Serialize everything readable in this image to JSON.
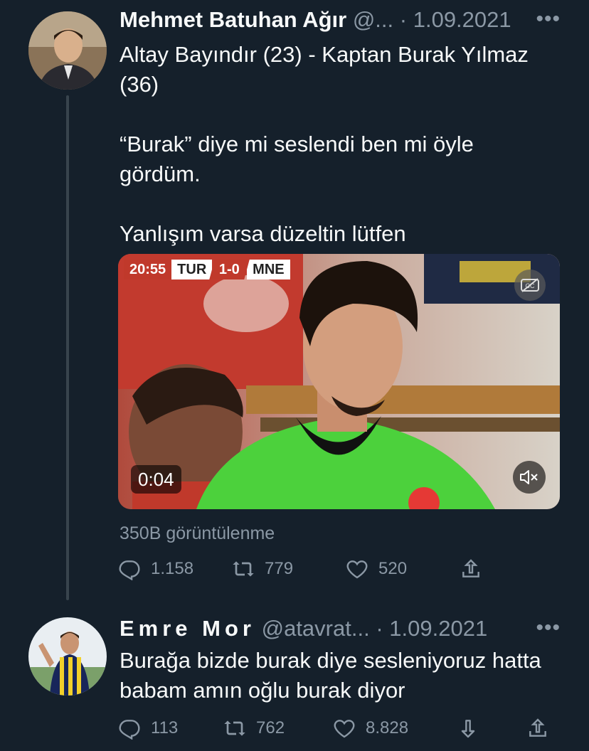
{
  "tweet1": {
    "author_name": "Mehmet Batuhan Ağır",
    "handle": "@...",
    "separator": "·",
    "date": "1.09.2021",
    "more_label": "•••",
    "text": "Altay Bayındır (23) - Kaptan Burak Yılmaz (36)\n\n“Burak” diye mi seslendi ben mi öyle gördüm.\n\nYanlışım varsa düzeltin lütfen",
    "media": {
      "scoreboard": {
        "clock": "20:55",
        "home": "TUR",
        "score": "1-0",
        "away": "MNE"
      },
      "duration": "0:04"
    },
    "views": "350B görüntülenme",
    "actions": {
      "replies": "1.158",
      "retweets": "779",
      "likes": "520"
    }
  },
  "tweet2": {
    "author_name": "Emre Mor",
    "handle": "@atavrat...",
    "separator": "·",
    "date": "1.09.2021",
    "more_label": "•••",
    "text": "Burağa bizde burak diye sesleniyoruz hatta babam amın oğlu burak diyor",
    "actions": {
      "replies": "113",
      "retweets": "762",
      "likes": "8.828"
    }
  },
  "colors": {
    "background": "#15202b",
    "text_primary": "#f7f9f9",
    "text_secondary": "#8b98a5",
    "thread_line": "#38444d"
  },
  "icons": [
    "reply-icon",
    "retweet-icon",
    "like-icon",
    "share-icon",
    "downvote-icon",
    "cc-icon",
    "mute-icon"
  ]
}
